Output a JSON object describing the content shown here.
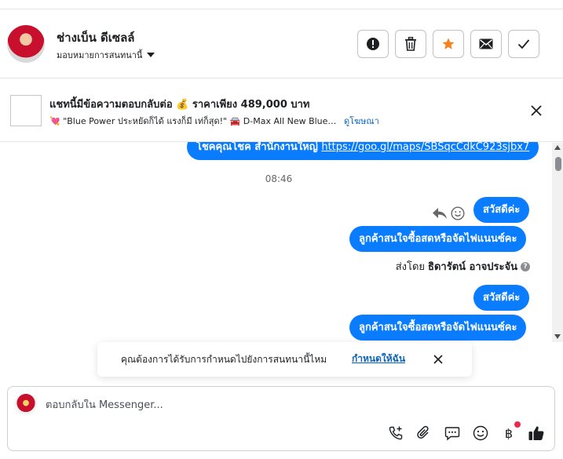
{
  "header": {
    "contact_name": "ช่างเบ็น ดีเซลล์",
    "assign_label": "มอบหมายการสนทนานี้",
    "actions": [
      "mark-spam",
      "delete",
      "star",
      "mark-unread",
      "mark-done"
    ]
  },
  "ad_banner": {
    "title": "แชทนี้มีข้อความตอบกลับต่อ 💰 ราคาเพียง 489,000 บาท",
    "subtitle": "💘 \"Blue Power ประหยัดก็ได้ แรงก็มี เท่ก็สุด!\" 🚘 D-Max All New Blue…",
    "ad_link": "ดูโฆษณา"
  },
  "messages": {
    "partial_prefix": "โชคคุณโชค สำนักงานใหญ่ ",
    "partial_link": "https://goo.gl/maps/SBSqcCdkC923sjbx7",
    "timestamp": "08:46",
    "m1": "สวัสดีค่ะ",
    "m2": "ลูกค้าสนใจซื้อสดหรือจัดไฟแนนซ์คะ",
    "sent_by_prefix": "ส่งโดย",
    "sent_by_name": "ธิดารัตน์ อาจประจัน",
    "m3": "สวัสดีค่ะ",
    "m4": "ลูกค้าสนใจซื้อสดหรือจัดไฟแนนซ์คะ"
  },
  "toast": {
    "text": "คุณต้องการได้รับการกำหนดไปยังการสนทนานี้ไหม",
    "link": "กำหนดให้ฉัน"
  },
  "composer": {
    "placeholder": "ตอบกลับใน Messenger...",
    "tools": [
      "call-add-icon",
      "attachment-icon",
      "saved-reply-icon",
      "emoji-icon",
      "baht-payment-icon",
      "thumbs-up-icon"
    ]
  },
  "colors": {
    "bubble": "#0a7cff",
    "link": "#0a64bc",
    "star": "#f5821f",
    "notification_dot": "#f02849"
  }
}
